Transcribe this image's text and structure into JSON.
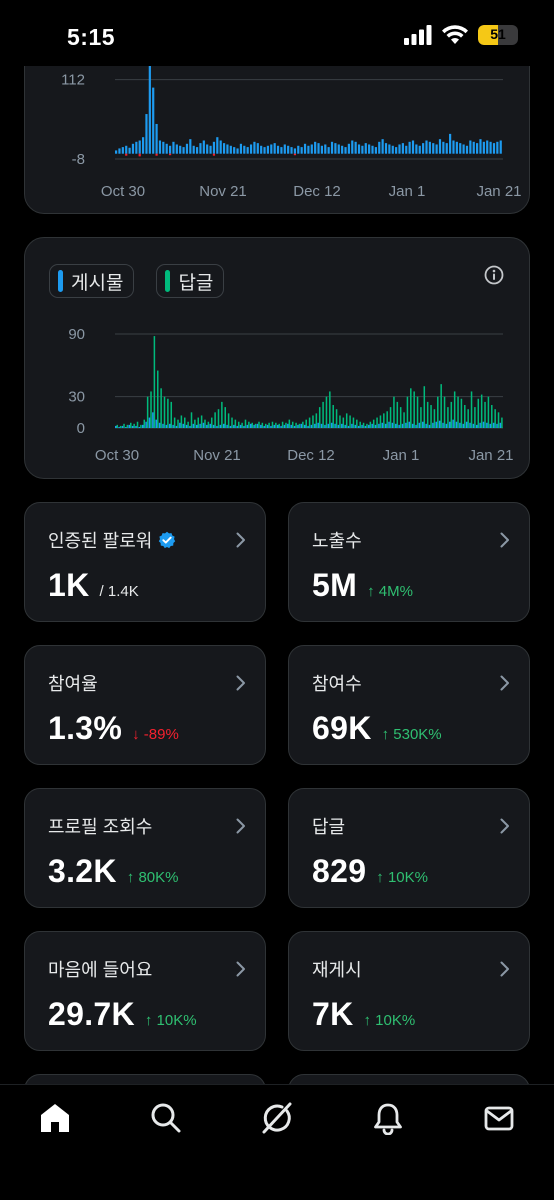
{
  "status_bar": {
    "time": "5:15",
    "battery": "51",
    "battery_level": 0.51,
    "battery_color": "#f5c816"
  },
  "posts_chart_card": {
    "chart_data": {
      "type": "bar",
      "x_ticks": [
        "Oct 30",
        "Nov 21",
        "Dec 12",
        "Jan 1",
        "Jan 21"
      ],
      "y_ticks": [
        "112",
        "-8"
      ],
      "ylim": [
        -8,
        231
      ],
      "series": [
        {
          "color": "#1d9bf0",
          "values": [
            5,
            8,
            10,
            12,
            9,
            15,
            18,
            20,
            25,
            60,
            231,
            100,
            45,
            20,
            18,
            15,
            12,
            18,
            14,
            12,
            10,
            15,
            22,
            12,
            10,
            16,
            20,
            14,
            12,
            18,
            25,
            20,
            16,
            14,
            12,
            10,
            8,
            15,
            12,
            10,
            14,
            18,
            16,
            12,
            10,
            12,
            14,
            16,
            12,
            10,
            14,
            12,
            10,
            8,
            12,
            10,
            15,
            12,
            14,
            18,
            16,
            12,
            14,
            10,
            18,
            16,
            14,
            12,
            10,
            15,
            20,
            18,
            14,
            12,
            16,
            14,
            12,
            10,
            18,
            22,
            16,
            14,
            12,
            10,
            14,
            16,
            12,
            18,
            20,
            14,
            12,
            16,
            20,
            18,
            16,
            14,
            22,
            18,
            16,
            30,
            20,
            18,
            16,
            14,
            12,
            20,
            18,
            16,
            22,
            18,
            20,
            18,
            16,
            18,
            20
          ]
        },
        {
          "color": "#f4212e",
          "values": [
            0,
            0,
            0,
            -3,
            0,
            0,
            0,
            -4,
            0,
            0,
            0,
            0,
            -3,
            0,
            0,
            0,
            -2,
            0,
            0,
            0,
            0,
            0,
            0,
            0,
            0,
            0,
            0,
            0,
            0,
            -3,
            0,
            0,
            0,
            0,
            0,
            0,
            0,
            0,
            0,
            0,
            0,
            0,
            0,
            0,
            0,
            0,
            0,
            0,
            0,
            0,
            0,
            0,
            0,
            -2,
            0,
            0,
            0,
            0,
            0,
            0,
            0,
            0,
            0,
            0,
            0,
            0,
            0,
            0,
            0,
            0,
            0,
            0,
            0,
            0,
            0,
            0,
            0,
            0,
            0,
            0,
            0,
            0,
            0,
            0,
            0,
            0,
            0,
            0,
            0,
            0,
            0,
            0,
            0,
            0,
            0,
            0,
            0,
            0,
            0,
            0,
            0,
            0,
            0,
            0,
            0,
            0,
            0,
            0,
            0,
            0,
            0,
            0,
            0,
            0,
            0
          ]
        }
      ]
    }
  },
  "replies_chart_card": {
    "legend": [
      {
        "label": "게시물",
        "color": "#1d9bf0"
      },
      {
        "label": "답글",
        "color": "#00ba7c"
      }
    ],
    "info_icon": "info-icon",
    "chart_data": {
      "type": "bar",
      "x_ticks": [
        "Oct 30",
        "Nov 21",
        "Dec 12",
        "Jan 1",
        "Jan 21"
      ],
      "y_ticks": [
        "90",
        "30",
        "0"
      ],
      "ylim": [
        0,
        90
      ],
      "grid": true,
      "series": [
        {
          "name": "게시물",
          "color": "#1d9bf0",
          "values": [
            2,
            1,
            2,
            1,
            3,
            2,
            2,
            1,
            3,
            6,
            10,
            15,
            8,
            5,
            4,
            3,
            4,
            3,
            2,
            5,
            4,
            3,
            2,
            4,
            3,
            4,
            5,
            3,
            4,
            3,
            2,
            3,
            4,
            3,
            2,
            3,
            2,
            3,
            2,
            3,
            4,
            3,
            4,
            3,
            2,
            3,
            2,
            3,
            3,
            2,
            3,
            4,
            3,
            2,
            3,
            4,
            3,
            2,
            3,
            4,
            5,
            4,
            3,
            4,
            5,
            4,
            3,
            4,
            3,
            2,
            4,
            3,
            2,
            3,
            2,
            3,
            4,
            3,
            4,
            5,
            4,
            6,
            5,
            4,
            3,
            4,
            5,
            6,
            4,
            3,
            5,
            6,
            4,
            3,
            5,
            6,
            7,
            5,
            4,
            6,
            8,
            6,
            5,
            4,
            6,
            5,
            4,
            3,
            5,
            6,
            5,
            4,
            5,
            4,
            5
          ]
        },
        {
          "name": "답글",
          "color": "#00ba7c",
          "values": [
            3,
            2,
            4,
            3,
            5,
            4,
            6,
            3,
            8,
            30,
            35,
            88,
            55,
            38,
            30,
            28,
            25,
            10,
            8,
            12,
            10,
            6,
            15,
            8,
            10,
            12,
            8,
            6,
            10,
            15,
            18,
            25,
            20,
            14,
            10,
            8,
            6,
            5,
            8,
            6,
            5,
            4,
            6,
            5,
            4,
            5,
            6,
            5,
            4,
            6,
            5,
            8,
            6,
            5,
            4,
            6,
            8,
            10,
            12,
            14,
            20,
            25,
            30,
            35,
            22,
            18,
            12,
            10,
            14,
            12,
            10,
            8,
            6,
            5,
            4,
            6,
            8,
            10,
            12,
            14,
            16,
            20,
            30,
            25,
            20,
            15,
            30,
            38,
            35,
            30,
            20,
            40,
            25,
            22,
            18,
            30,
            42,
            30,
            20,
            25,
            35,
            30,
            28,
            22,
            18,
            35,
            20,
            28,
            32,
            25,
            30,
            22,
            18,
            15,
            10
          ]
        }
      ]
    }
  },
  "stats": [
    {
      "label": "인증된 팔로워",
      "value": "1K",
      "sub": "/ 1.4K",
      "change": "",
      "trend": "none",
      "verified": true
    },
    {
      "label": "노출수",
      "value": "5M",
      "sub": "",
      "change": "↑ 4M%",
      "trend": "up",
      "verified": false
    },
    {
      "label": "참여율",
      "value": "1.3%",
      "sub": "",
      "change": "↓ -89%",
      "trend": "down",
      "verified": false
    },
    {
      "label": "참여수",
      "value": "69K",
      "sub": "",
      "change": "↑ 530K%",
      "trend": "up",
      "verified": false
    },
    {
      "label": "프로필 조회수",
      "value": "3.2K",
      "sub": "",
      "change": "↑ 80K%",
      "trend": "up",
      "verified": false
    },
    {
      "label": "답글",
      "value": "829",
      "sub": "",
      "change": "↑ 10K%",
      "trend": "up",
      "verified": false
    },
    {
      "label": "마음에 들어요",
      "value": "29.7K",
      "sub": "",
      "change": "↑ 10K%",
      "trend": "up",
      "verified": false
    },
    {
      "label": "재게시",
      "value": "7K",
      "sub": "",
      "change": "↑ 10K%",
      "trend": "up",
      "verified": false
    }
  ],
  "bottom_nav": {
    "items": [
      {
        "name": "home-icon",
        "active": true
      },
      {
        "name": "search-icon",
        "active": false
      },
      {
        "name": "grok-icon",
        "active": false
      },
      {
        "name": "notifications-icon",
        "active": false
      },
      {
        "name": "messages-icon",
        "active": false
      }
    ]
  },
  "colors": {
    "background": "#000000",
    "card": "#16181c",
    "border": "#2f3336",
    "blue": "#1d9bf0",
    "green": "#00ba7c",
    "up": "#2fbf71",
    "down": "#f4212e"
  }
}
